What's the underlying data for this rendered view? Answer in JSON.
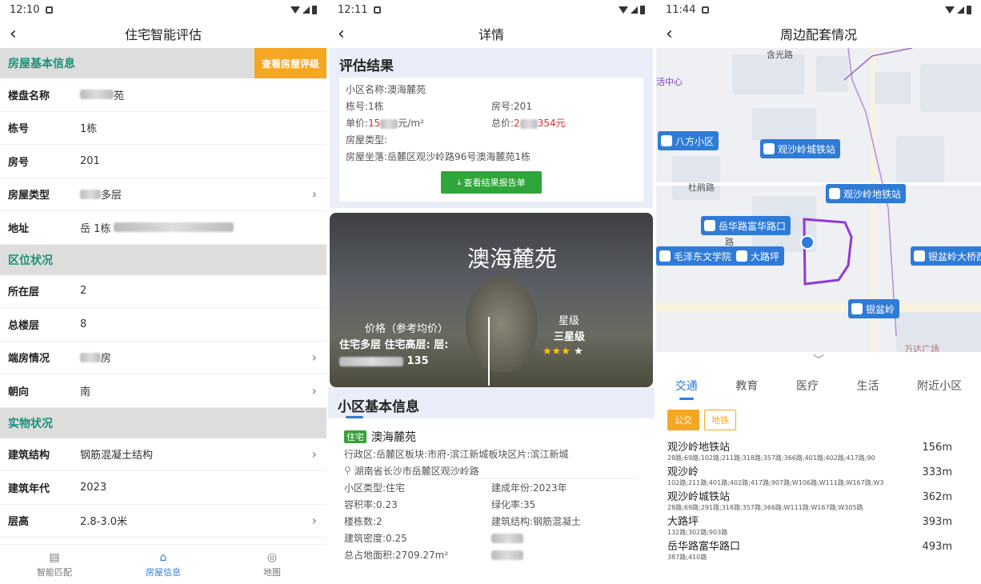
{
  "p1": {
    "time": "12:10",
    "title": "住宅智能评估",
    "sections": [
      {
        "label": "房屋基本信息",
        "button": "查看房屋评级"
      },
      {
        "label": "区位状况"
      },
      {
        "label": "实物状况"
      }
    ],
    "basic": [
      {
        "label": "楼盘名称",
        "value": "苑"
      },
      {
        "label": "栋号",
        "value": "1栋"
      },
      {
        "label": "房号",
        "value": "201"
      },
      {
        "label": "房屋类型",
        "value": "多层"
      },
      {
        "label": "地址",
        "value": "岳 1栋"
      }
    ],
    "location": [
      {
        "label": "所在层",
        "value": "2"
      },
      {
        "label": "总楼层",
        "value": "8"
      },
      {
        "label": "端房情况",
        "value": "房"
      },
      {
        "label": "朝向",
        "value": "南"
      }
    ],
    "physical": [
      {
        "label": "建筑结构",
        "value": "钢筋混凝土结构"
      },
      {
        "label": "建筑年代",
        "value": "2023"
      },
      {
        "label": "层高",
        "value": "2.8-3.0米"
      }
    ],
    "tabs": [
      "智能匹配",
      "房屋信息",
      "地图"
    ]
  },
  "p2": {
    "time": "12:11",
    "title": "详情",
    "result_head": "评估结果",
    "result": {
      "community": "小区名称:澳海麓苑",
      "building": "栋号:1栋",
      "room": "房号:201",
      "unit_label": "单价:",
      "unit_value": "15",
      "unit_suffix": "元/m²",
      "total_label": "总价:",
      "total_value": "2",
      "total_suffix": "354元",
      "type": "房屋类型:",
      "address": "房屋坐落:岳麓区观沙岭路96号澳海麓苑1栋",
      "button": "查看结果报告单"
    },
    "hero": {
      "name": "澳海麓苑",
      "price_label": "价格（参考均价）",
      "price_text": "住宅多层 住宅高层: 层:",
      "price_tail": "135",
      "star_label": "星级",
      "star_value": "三星级",
      "stars": "★★★",
      "stars_off": "★"
    },
    "sub_head": "小区基本信息",
    "info": {
      "tag": "住宅",
      "name": "澳海麓苑",
      "district": "行政区:岳麓区板块:市府-滨江新城板块区片:滨江新城",
      "address": "湖南省长沙市岳麓区观沙岭路",
      "type": "小区类型:住宅",
      "year": "建成年份:2023年",
      "far": "容积率:0.23",
      "green": "绿化率:35",
      "count": "楼栋数:2",
      "struct": "建筑结构:钢筋混凝土",
      "density": "建筑密度:0.25",
      "area": "总占地面积:2709.27m²"
    }
  },
  "p3": {
    "time": "11:44",
    "title": "周边配套情况",
    "map_labels": [
      "杜鹃路",
      "路",
      "万达广场",
      "活中心",
      "含光路"
    ],
    "markers": [
      "八方小区",
      "观沙岭城铁站",
      "观沙岭地铁站",
      "岳华路富华路口",
      "毛泽东文学院",
      "大路坪",
      "银盆岭大桥西",
      "银盆岭"
    ],
    "tabs": [
      "交通",
      "教育",
      "医疗",
      "生活",
      "附近小区"
    ],
    "chips": [
      "公交",
      "地铁"
    ],
    "pois": [
      {
        "name": "观沙岭地铁站",
        "lines": "28路;69路;102路;211路;318路;357路;366路;401路;402路;417路;90",
        "dist": "156m"
      },
      {
        "name": "观沙岭",
        "lines": "102路;211路;401路;402路;417路;907路;W106路;W111路;W167路;W3",
        "dist": "333m"
      },
      {
        "name": "观沙岭城铁站",
        "lines": "28路;69路;291路;318路;357路;366路;W111路;W167路;W305路",
        "dist": "362m"
      },
      {
        "name": "大路坪",
        "lines": "132路;302路;903路",
        "dist": "393m"
      },
      {
        "name": "岳华路富华路口",
        "lines": "387路;410路",
        "dist": "493m"
      }
    ]
  }
}
